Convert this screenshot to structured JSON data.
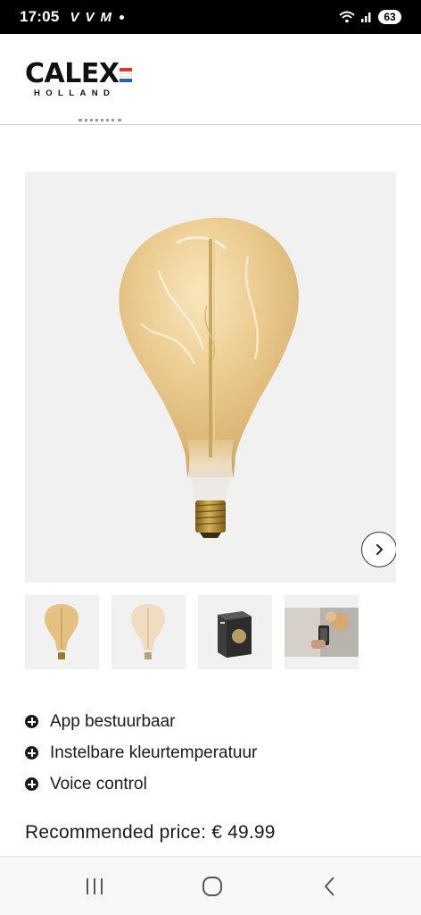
{
  "status_bar": {
    "time": "17:05",
    "app_icons": [
      "V",
      "V",
      "M"
    ],
    "battery": "63"
  },
  "brand": {
    "name": "CALEX",
    "sub": "HOLLAND",
    "flag_colors": [
      "#e0342b",
      "#ffffff",
      "#2c5fb3"
    ]
  },
  "gallery": {
    "next_icon": "chevron-right-icon",
    "thumbnails": [
      "bulb-gold",
      "bulb-light",
      "product-box",
      "lifestyle-photo"
    ]
  },
  "features": [
    {
      "label": "App bestuurbaar",
      "icon": "plus-circle-icon"
    },
    {
      "label": "Instelbare kleurtemperatuur",
      "icon": "plus-circle-icon"
    },
    {
      "label": "Voice control",
      "icon": "plus-circle-icon"
    }
  ],
  "price": {
    "label": "Recommended price: € 49.99"
  },
  "nav_bar": {
    "icons": [
      "recent-apps-icon",
      "home-icon",
      "back-icon"
    ]
  },
  "colors": {
    "bulb_glass": "#e8c88c",
    "bulb_base": "#b8912f",
    "background_panel": "#f1f1f1"
  }
}
